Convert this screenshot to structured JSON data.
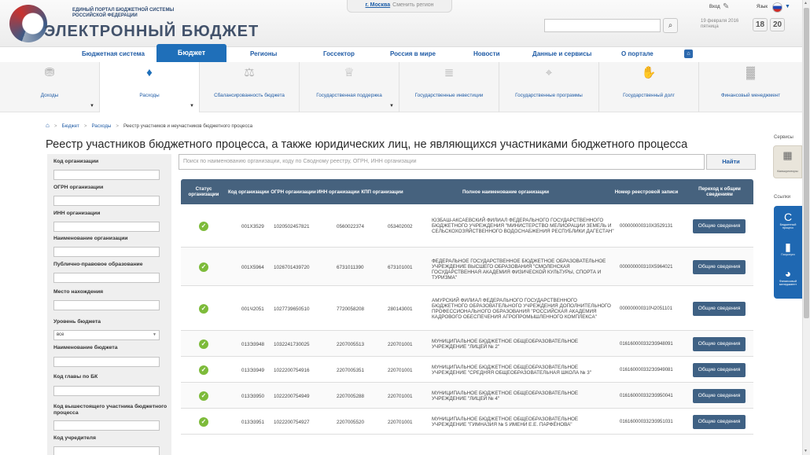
{
  "header": {
    "portal_name": "ЕДИНЫЙ ПОРТАЛ БЮДЖЕТНОЙ СИСТЕМЫ РОССИЙСКОЙ ФЕДЕРАЦИИ",
    "title": "ЭЛЕКТРОННЫЙ БЮДЖЕТ",
    "region_link": "г. Москва",
    "region_change": "Сменить регион",
    "login": "Вход",
    "language": "Язык",
    "date": "19 февраля 2016 пятница",
    "font_small": "18",
    "font_large": "20",
    "search_placeholder": ""
  },
  "main_nav": {
    "items": [
      "Бюджетная система",
      "Бюджет",
      "Регионы",
      "Госсектор",
      "Россия в мире",
      "Новости",
      "Данные и сервисы",
      "О портале"
    ],
    "active": "Бюджет"
  },
  "sub_nav": {
    "items": [
      {
        "label": "Доходы",
        "icon": "coins-icon"
      },
      {
        "label": "Расходы",
        "icon": "money-bag-icon"
      },
      {
        "label": "Сбалансированность бюджета",
        "icon": "scales-icon"
      },
      {
        "label": "Государственная поддержка",
        "icon": "eagle-icon"
      },
      {
        "label": "Государственные инвестиции",
        "icon": "coins-stack-icon"
      },
      {
        "label": "Государственные программы",
        "icon": "target-icon"
      },
      {
        "label": "Государственный долг",
        "icon": "hand-coins-icon"
      },
      {
        "label": "Финансовый менеджмент",
        "icon": "chart-icon"
      }
    ],
    "selected": "Расходы"
  },
  "breadcrumb": {
    "items": [
      "Бюджет",
      "Расходы"
    ],
    "current": "Реестр участников и неучастников бюджетного процесса"
  },
  "page_title": "Реестр участников бюджетного процесса, а также юридических лиц, не являющихся участниками бюджетного процесса",
  "filters": {
    "org_code": "Код организации",
    "ogrn": "ОГРН организации",
    "inn": "ИНН организации",
    "org_name": "Наименование организации",
    "public_entity": "Публично-правовое образование",
    "location": "Место нахождения",
    "budget_level": "Уровень бюджета",
    "budget_level_value": "все",
    "budget_name": "Наименование бюджета",
    "bk_head_code": "Код главы по БК",
    "parent_code": "Код вышестоящего участника бюджетного процесса",
    "founder_code": "Код учредителя"
  },
  "search": {
    "placeholder": "Поиск по наименованию организации, коду по Сводному реестру, ОГРН, ИНН организации",
    "button": "Найти"
  },
  "table": {
    "headers": [
      "Статус организации",
      "Код организации",
      "ОГРН организации",
      "ИНН организации",
      "КПП организации",
      "Полное наименование организации",
      "Номер реестровой записи",
      "Переход к общим сведениям"
    ],
    "rows": [
      {
        "code": "001X3529",
        "ogrn": "1020502457821",
        "inn": "0560022374",
        "kpp": "053402002",
        "name": "ЮЗБАШ-АКСАЕВСКИЙ ФИЛИАЛ ФЕДЕРАЛЬНОГО ГОСУДАРСТВЕННОГО БЮДЖЕТНОГО УЧРЕЖДЕНИЯ \"МИНИСТЕРСТВО МЕЛИОРАЦИИ ЗЕМЕЛЬ И СЕЛЬСКОХОЗЯЙСТВЕННОГО ВОДОСНАБЖЕНИЯ РЕСПУБЛИКИ ДАГЕСТАН\"",
        "reg": "00000000031​0X3529131",
        "button": "Общие сведения"
      },
      {
        "code": "001X5964",
        "ogrn": "1026701439720",
        "inn": "6731011390",
        "kpp": "673101001",
        "name": "ФЕДЕРАЛЬНОЕ ГОСУДАРСТВЕННОЕ БЮДЖЕТНОЕ ОБРАЗОВАТЕЛЬНОЕ УЧРЕЖДЕНИЕ ВЫСШЕГО ОБРАЗОВАНИЯ \"СМОЛЕНСКАЯ ГОСУДАРСТВЕННАЯ АКАДЕМИЯ ФИЗИЧЕСКОЙ КУЛЬТУРЫ, СПОРТА И ТУРИЗМА\"",
        "reg": "00000000031​0X5964021",
        "button": "Общие сведения"
      },
      {
        "code": "001Ч2051",
        "ogrn": "1027739650510",
        "inn": "7720058208",
        "kpp": "280143001",
        "name": "АМУРСКИЙ ФИЛИАЛ ФЕДЕРАЛЬНОГО ГОСУДАРСТВЕННОГО БЮДЖЕТНОГО ОБРАЗОВАТЕЛЬНОГО УЧРЕЖДЕНИЯ ДОПОЛНИТЕЛЬНОГО ПРОФЕССИОНАЛЬНОГО ОБРАЗОВАНИЯ \"РОССИЙСКАЯ АКАДЕМИЯ КАДРОВОГО ОБЕСПЕЧЕНИЯ АГРОПРОМЫШЛЕННОГО КОМПЛЕКСА\"",
        "reg": "00000000031​0Ч2051101",
        "button": "Общие сведения"
      },
      {
        "code": "013Э3948",
        "ogrn": "1032241730025",
        "inn": "2207005513",
        "kpp": "220701001",
        "name": "МУНИЦИПАЛЬНОЕ БЮДЖЕТНОЕ ОБЩЕОБРАЗОВАТЕЛЬНОЕ УЧРЕЖДЕНИЕ \"ЛИЦЕЙ № 2\"",
        "reg": "016160000332Э3948091",
        "button": "Общие сведения"
      },
      {
        "code": "013Э3949",
        "ogrn": "1022200754916",
        "inn": "2207005351",
        "kpp": "220701001",
        "name": "МУНИЦИПАЛЬНОЕ БЮДЖЕТНОЕ ОБЩЕОБРАЗОВАТЕЛЬНОЕ УЧРЕЖДЕНИЕ \"СРЕДНЯЯ ОБЩЕОБРАЗОВАТЕЛЬНАЯ ШКОЛА № 3\"",
        "reg": "016160000332Э3949081",
        "button": "Общие сведения"
      },
      {
        "code": "013Э3950",
        "ogrn": "1022200754949",
        "inn": "2207005288",
        "kpp": "220701001",
        "name": "МУНИЦИПАЛЬНОЕ БЮДЖЕТНОЕ ОБЩЕОБРАЗОВАТЕЛЬНОЕ УЧРЕЖДЕНИЕ \"ЛИЦЕЙ № 4\"",
        "reg": "016160000332Э3950041",
        "button": "Общие сведения"
      },
      {
        "code": "013Э3951",
        "ogrn": "1022200754927",
        "inn": "2207005520",
        "kpp": "220701001",
        "name": "МУНИЦИПАЛЬНОЕ БЮДЖЕТНОЕ ОБЩЕОБРАЗОВАТЕЛЬНОЕ УЧРЕЖДЕНИЕ \"ГИМНАЗИЯ № 5 ИМЕНИ Е.Е. ПАРФЁНОВА\"",
        "reg": "016160000332Э3951031",
        "button": "Общие сведения"
      }
    ]
  },
  "side_panel": {
    "services_label": "Сервисы",
    "calculator_label": "Калькуляторы",
    "links_label": "Ссылки",
    "links": [
      "Бюджетный процесс",
      "Госуслуги",
      "Финансовый менеджмент"
    ]
  },
  "colors": {
    "brand_blue": "#1f6fb9",
    "table_header": "#46627e",
    "status_ok": "#7dbb3a",
    "button": "#3f6184"
  }
}
